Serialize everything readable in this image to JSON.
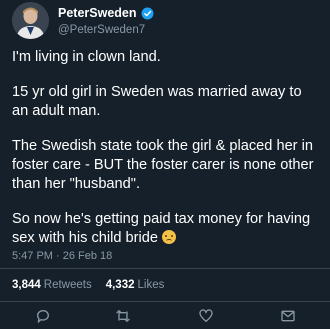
{
  "tweet": {
    "display_name": "PeterSweden",
    "handle": "@PeterSweden7",
    "paragraphs": [
      "I'm living in clown land.",
      "15 yr old girl in Sweden was married away to\nan adult man.",
      "The Swedish state took the girl & placed her in\nfoster care - BUT the foster carer is none other\nthan her \"husband\".",
      "So now he's getting paid tax money for having\nsex with his child bride"
    ],
    "emoji": "pensive-face-emoji",
    "timestamp": "5:47 PM · 26 Feb 18",
    "retweets_count": "3,844",
    "retweets_label": "Retweets",
    "likes_count": "4,332",
    "likes_label": "Likes"
  },
  "icons": [
    "verified-badge-icon",
    "reply-icon",
    "retweet-icon",
    "like-icon",
    "share-icon"
  ],
  "colors": {
    "background": "#15202b",
    "secondary_text": "#8899a6",
    "verified": "#1da1f2",
    "divider": "#38444d"
  }
}
